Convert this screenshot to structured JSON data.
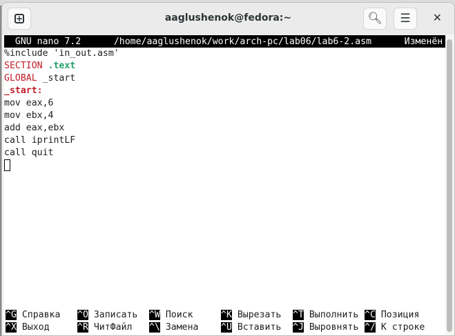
{
  "window": {
    "title": "aaglushenok@fedora:~",
    "new_tab_icon": "plus-square-icon",
    "search_icon": "search-icon",
    "menu_icon": "hamburger-icon",
    "close_icon": "close-icon"
  },
  "nano": {
    "version": "GNU nano 7.2",
    "path": "/home/aaglushenok/work/arch-pc/lab06/lab6-2.asm",
    "status": "Изменён"
  },
  "code": [
    [
      {
        "t": "%include 'in_out.asm'",
        "c": ""
      }
    ],
    [
      {
        "t": "SECTION",
        "c": "red"
      },
      {
        "t": " ",
        "c": ""
      },
      {
        "t": ".text",
        "c": "green"
      }
    ],
    [
      {
        "t": "GLOBAL",
        "c": "red"
      },
      {
        "t": " _start",
        "c": ""
      }
    ],
    [
      {
        "t": "_start:",
        "c": "redb"
      }
    ],
    [
      {
        "t": "mov eax,6",
        "c": ""
      }
    ],
    [
      {
        "t": "mov ebx,4",
        "c": ""
      }
    ],
    [
      {
        "t": "add eax,ebx",
        "c": ""
      }
    ],
    [
      {
        "t": "call iprintLF",
        "c": ""
      }
    ],
    [
      {
        "t": "call quit",
        "c": ""
      }
    ]
  ],
  "shortcuts": [
    [
      {
        "k": "^G",
        "l": "Справка"
      },
      {
        "k": "^O",
        "l": "Записать"
      },
      {
        "k": "^W",
        "l": "Поиск"
      },
      {
        "k": "^K",
        "l": "Вырезать"
      },
      {
        "k": "^T",
        "l": "Выполнить"
      },
      {
        "k": "^C",
        "l": "Позиция"
      }
    ],
    [
      {
        "k": "^X",
        "l": "Выход"
      },
      {
        "k": "^R",
        "l": "ЧитФайл"
      },
      {
        "k": "^\\",
        "l": "Замена"
      },
      {
        "k": "^U",
        "l": "Вставить"
      },
      {
        "k": "^J",
        "l": "Выровнять"
      },
      {
        "k": "^/",
        "l": "К строке"
      }
    ]
  ]
}
